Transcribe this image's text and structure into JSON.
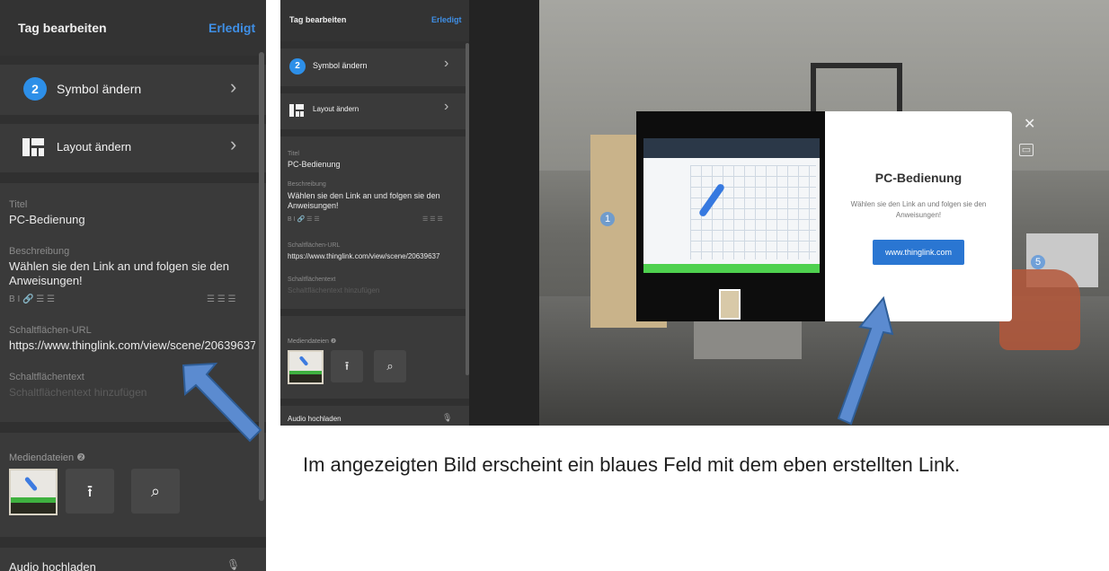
{
  "panel": {
    "title": "Tag bearbeiten",
    "done_label": "Erledigt",
    "symbol_row": {
      "badge": "2",
      "label": "Symbol ändern"
    },
    "layout_row": {
      "label": "Layout ändern",
      "icon": "layout-icon"
    },
    "chevron": "›",
    "title_field": {
      "label": "Titel",
      "value": "PC-Bedienung"
    },
    "description_field": {
      "label": "Beschreibung",
      "value": "Wählen sie den Link an und folgen sie den Anweisungen!"
    },
    "format_toolbar": {
      "left": "B  I  🔗  ☰  ☰",
      "right": "☰  ☰  ☰"
    },
    "button_url_field": {
      "label": "Schaltflächen-URL",
      "value": "https://www.thinglink.com/view/scene/20639637"
    },
    "button_text_field": {
      "label": "Schaltflächentext",
      "placeholder": "Schaltflächentext hinzufügen"
    },
    "media": {
      "label": "Mediendateien ❷",
      "upload_icon": "⭱",
      "search_icon": "⌕"
    },
    "audio": {
      "label": "Audio hochladen",
      "mic_icon": "🎙"
    }
  },
  "panel_small": {
    "button_url_value": "https://www.thinglink.com/view/scene/20639637",
    "media_label": "Mediendateien ❷"
  },
  "scene": {
    "popup_title": "PC-Bedienung",
    "popup_description": "Wählen sie den Link an und folgen sie den Anweisungen!",
    "popup_link": "www.thinglink.com",
    "hotspot_1": "1",
    "hotspot_5": "5",
    "close": "✕",
    "control": "▭"
  },
  "caption": "Im angezeigten Bild erscheint ein blaues Feld mit dem eben erstellten Link.",
  "colors": {
    "accent": "#2d8fe8",
    "panel_bg": "#3a3a3a",
    "arrow": "#5b8bd0"
  }
}
